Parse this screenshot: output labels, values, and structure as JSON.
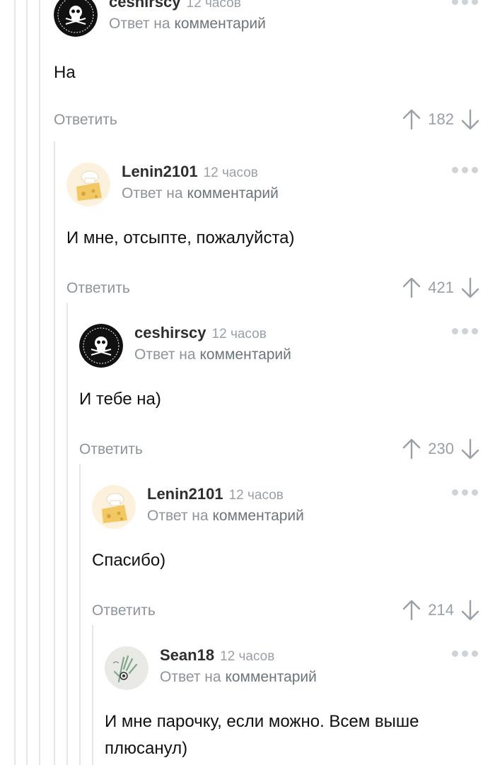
{
  "comments": [
    {
      "author": "ceshirscy",
      "time": "12 часов",
      "reply_prefix": "Ответ на",
      "reply_link": "комментарий",
      "text": "На",
      "reply_label": "Ответить",
      "rating": "182",
      "avatar_icon": "skull-emblem-avatar"
    },
    {
      "author": "Lenin2101",
      "time": "12 часов",
      "reply_prefix": "Ответ на",
      "reply_link": "комментарий",
      "text": "И мне, отсыпте, пожалуйста)",
      "reply_label": "Ответить",
      "rating": "421",
      "avatar_icon": "cheese-chef-avatar"
    },
    {
      "author": "ceshirscy",
      "time": "12 часов",
      "reply_prefix": "Ответ на",
      "reply_link": "комментарий",
      "text": "И тебе на)",
      "reply_label": "Ответить",
      "rating": "230",
      "avatar_icon": "skull-emblem-avatar"
    },
    {
      "author": "Lenin2101",
      "time": "12 часов",
      "reply_prefix": "Ответ на",
      "reply_link": "комментарий",
      "text": "Спасибо)",
      "reply_label": "Ответить",
      "rating": "214",
      "avatar_icon": "cheese-chef-avatar"
    },
    {
      "author": "Sean18",
      "time": "12 часов",
      "reply_prefix": "Ответ на",
      "reply_link": "комментарий",
      "text": "И мне парочку, если можно. Всем выше плюсанул)",
      "avatar_icon": "hand-sketch-avatar"
    }
  ],
  "colors": {
    "muted_text": "#8e9499",
    "link_text": "#6e757a",
    "thread_line": "#e4e6e8",
    "body_text": "#111111"
  }
}
